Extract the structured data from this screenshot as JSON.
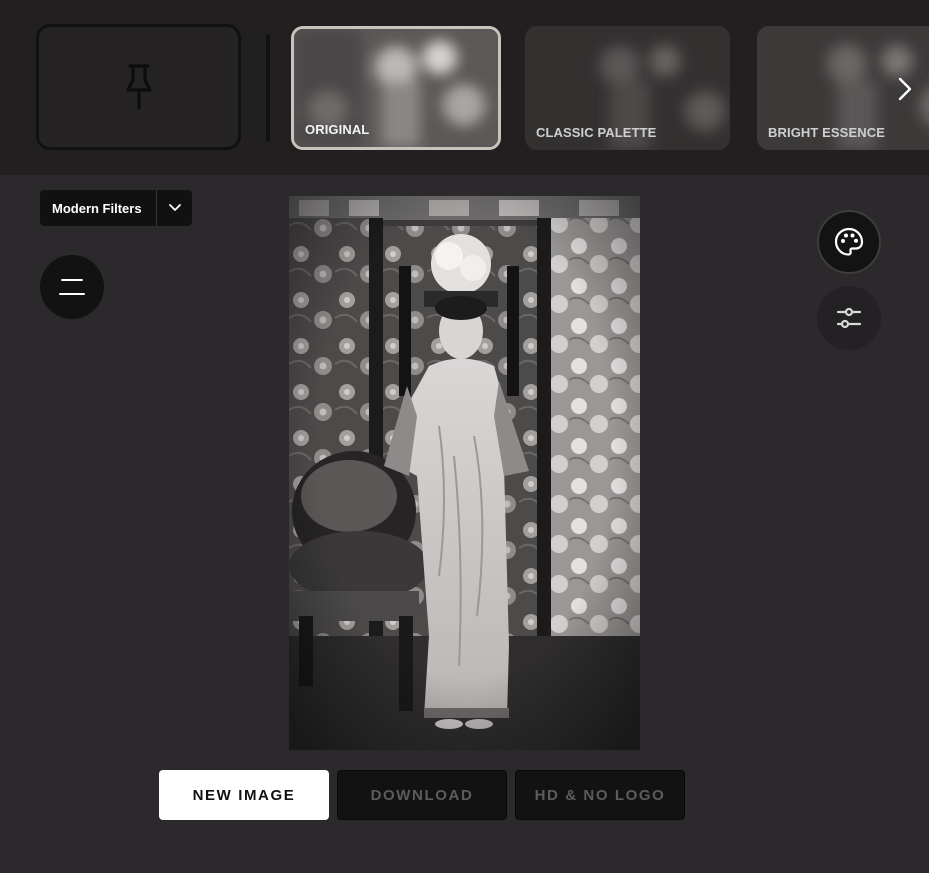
{
  "filters_bar": {
    "thumbnails": [
      {
        "label": "ORIGINAL",
        "selected": true
      },
      {
        "label": "CLASSIC PALETTE",
        "selected": false
      },
      {
        "label": "BRIGHT ESSENCE",
        "selected": false
      }
    ],
    "pin_icon": "pushpin-icon",
    "next_icon": "chevron-right-icon"
  },
  "sidebar": {
    "filter_dropdown": {
      "selected": "Modern Filters",
      "icon": "chevron-down-icon"
    },
    "menu_icon": "hamburger-icon"
  },
  "tools": {
    "palette_icon": "palette-icon",
    "adjust_icon": "sliders-icon"
  },
  "actions": {
    "new_image": "NEW IMAGE",
    "download": "DOWNLOAD",
    "hd_no_logo": "HD & NO LOGO"
  },
  "colors": {
    "background": "#2b292b",
    "topbar": "#221f20",
    "primary_button": "#ffffff",
    "dark_button": "#131213"
  }
}
